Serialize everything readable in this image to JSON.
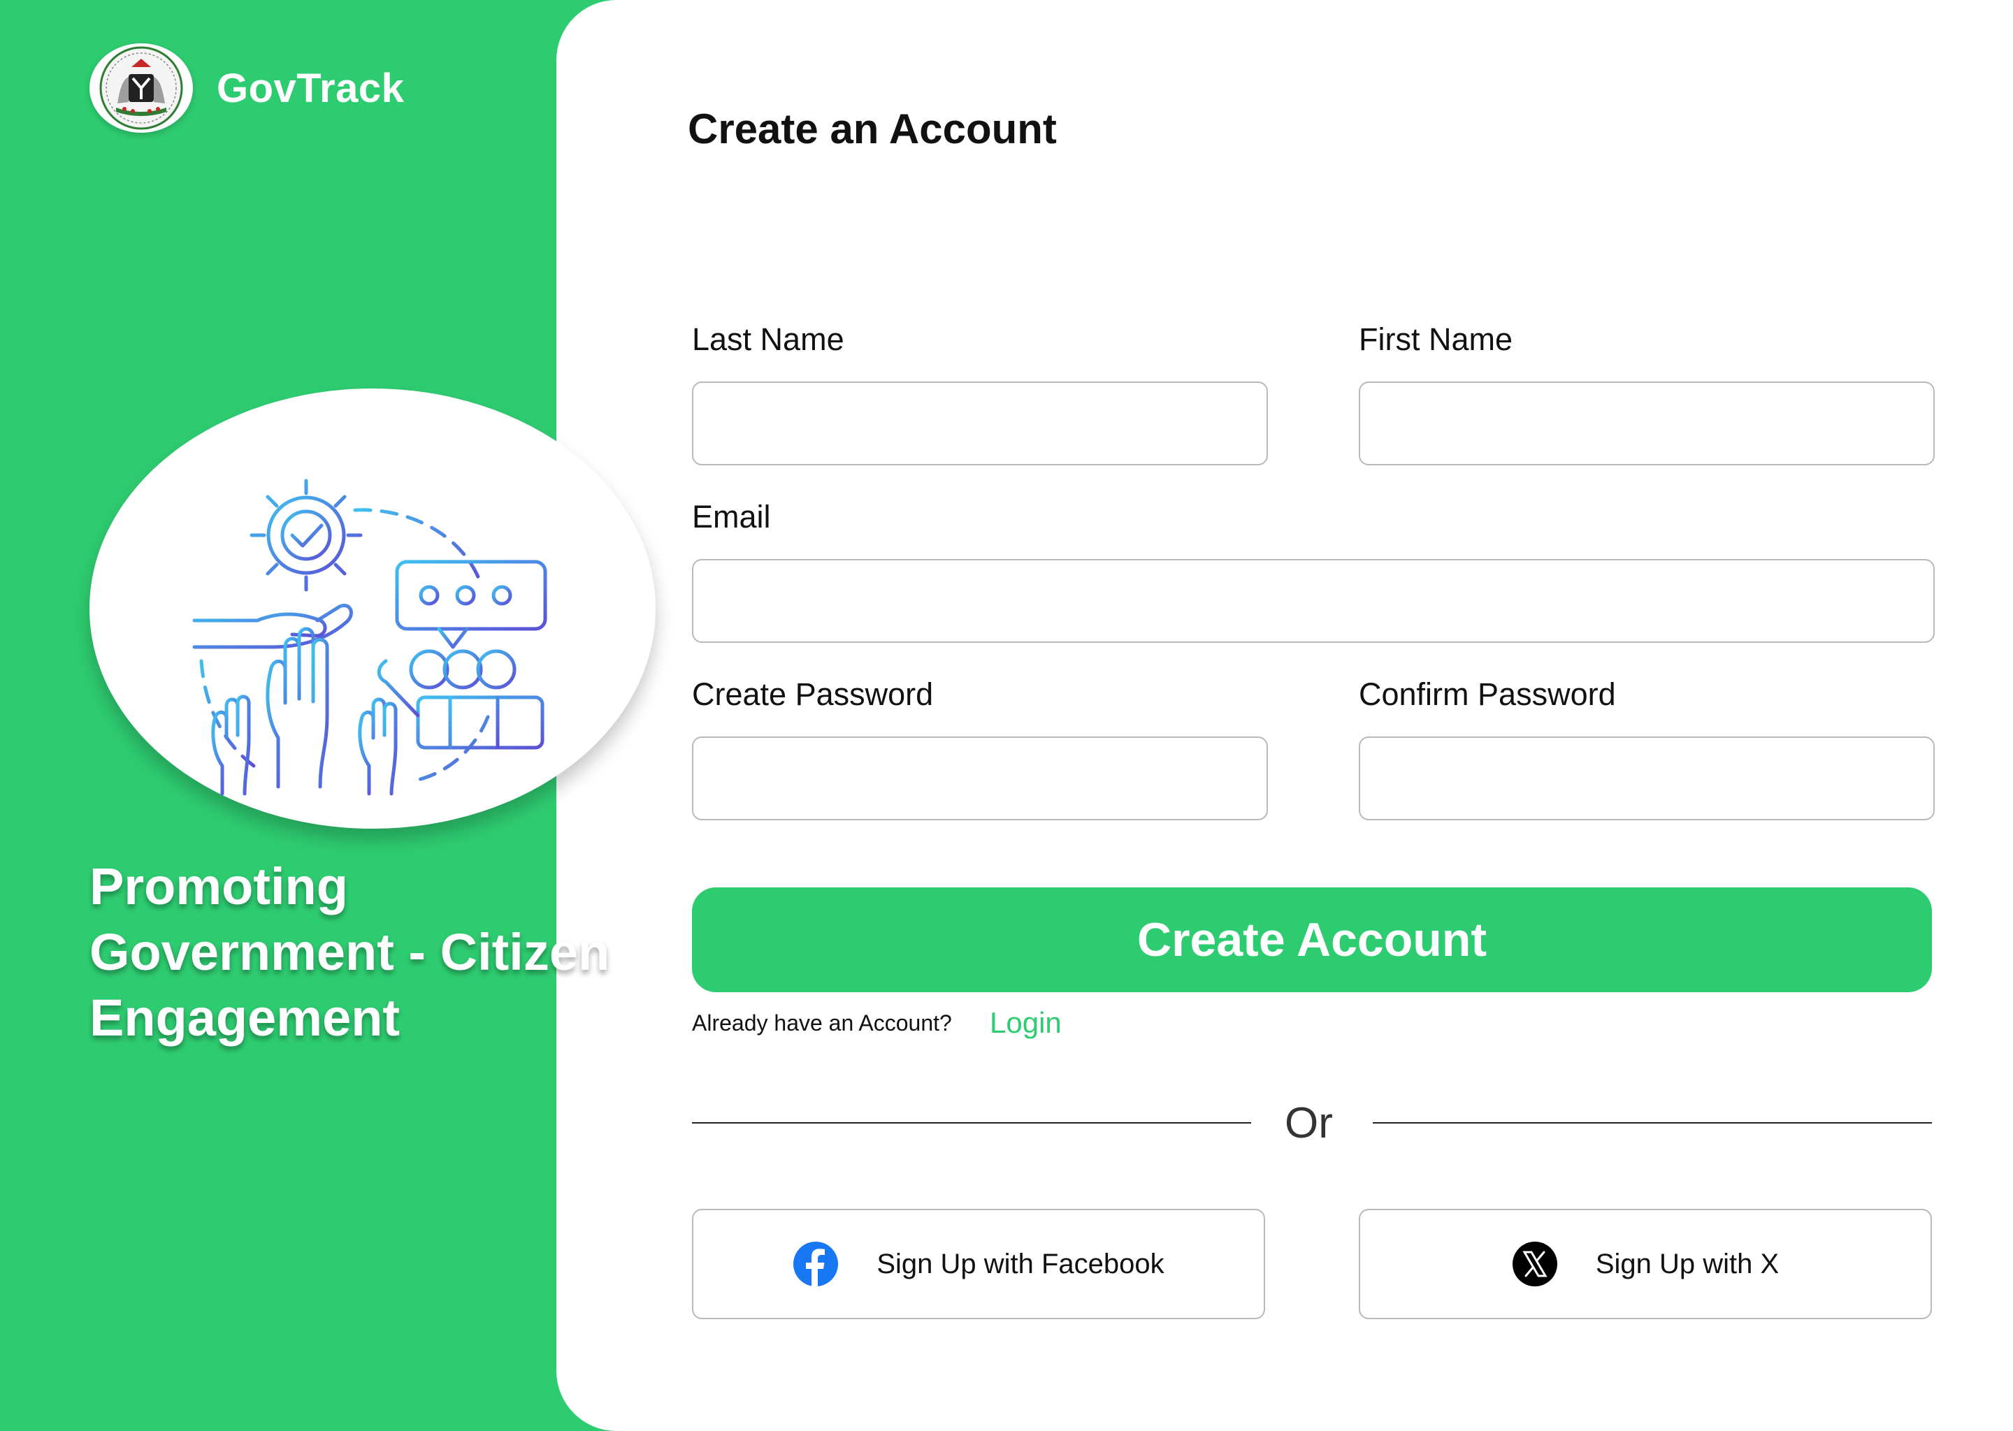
{
  "brand": {
    "name": "GovTrack",
    "seal_icon": "coat-of-arms-icon"
  },
  "hero": {
    "illustration": "civic-engagement-illustration",
    "tagline_lines": [
      "Promoting",
      "Government - Citizen",
      "Engagement"
    ]
  },
  "form": {
    "title": "Create an Account",
    "last_name": {
      "label": "Last Name",
      "value": "",
      "placeholder": ""
    },
    "first_name": {
      "label": "First Name",
      "value": "",
      "placeholder": ""
    },
    "email": {
      "label": "Email",
      "value": "",
      "placeholder": ""
    },
    "create_password": {
      "label": "Create Password",
      "value": "",
      "placeholder": ""
    },
    "confirm_password": {
      "label": "Confirm Password",
      "value": "",
      "placeholder": ""
    },
    "submit_label": "Create Account",
    "already_text": "Already have an Account?",
    "login_label": "Login",
    "divider_text": "Or",
    "facebook": {
      "label": "Sign Up with Facebook",
      "icon": "facebook-icon"
    },
    "x": {
      "label": "Sign Up with X",
      "icon": "x-logo-icon"
    }
  },
  "colors": {
    "accent": "#2ecc71",
    "panel": "#ffffff",
    "facebook_blue": "#1877f2",
    "text": "#111111"
  }
}
